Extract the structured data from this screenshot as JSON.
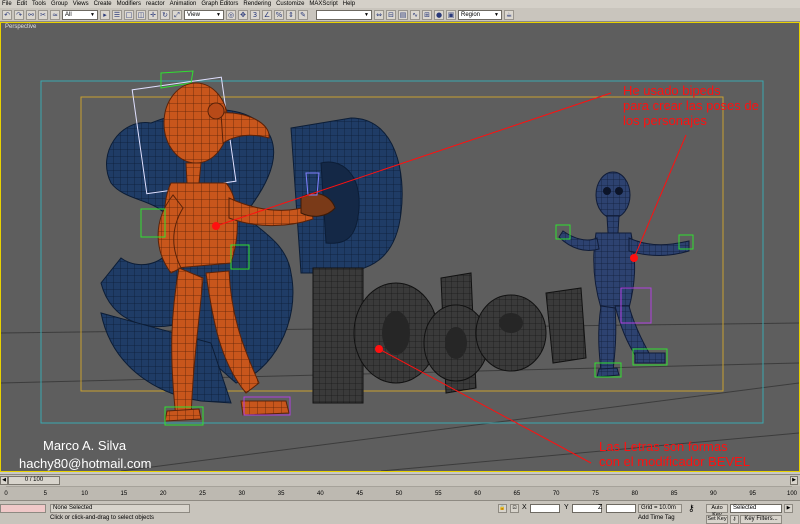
{
  "menu": [
    "File",
    "Edit",
    "Tools",
    "Group",
    "Views",
    "Create",
    "Modifiers",
    "reactor",
    "Animation",
    "Graph Editors",
    "Rendering",
    "Customize",
    "MAXScript",
    "Help"
  ],
  "toolbar": {
    "filter_select": "All",
    "view_select": "View",
    "region_select": "Region",
    "named_sel": ""
  },
  "viewport": {
    "label": "Perspective",
    "annotation_top": [
      "He usado bipeds",
      "para crear las poses de",
      "los personajes"
    ],
    "annotation_bottom": [
      "Las Letras son formas",
      "con el modificador BEVEL"
    ],
    "credit_name": "Marco A. Silva",
    "credit_email": "hachy80@hotmail.com",
    "colors": {
      "annotation": "#ff1010",
      "grid": "#e8d200",
      "logo": "#1f3c66",
      "character_orange": "#c8561c",
      "character_blue": "#2d4270"
    }
  },
  "timeslider": {
    "label": "0 / 100"
  },
  "trackbar": {
    "ticks": [
      "0",
      "5",
      "10",
      "15",
      "20",
      "25",
      "30",
      "35",
      "40",
      "45",
      "50",
      "55",
      "60",
      "65",
      "70",
      "75",
      "80",
      "85",
      "90",
      "95",
      "100"
    ]
  },
  "status": {
    "selection": "None Selected",
    "prompt": "Click or click-and-drag to select objects",
    "x_label": "X",
    "y_label": "Y",
    "z_label": "Z",
    "grid": "Grid = 10.0m",
    "add_time_tag": "Add Time Tag",
    "auto_key": "Auto Key",
    "set_key": "Set Key",
    "selected": "Selected",
    "key_filters": "Key Filters..."
  }
}
